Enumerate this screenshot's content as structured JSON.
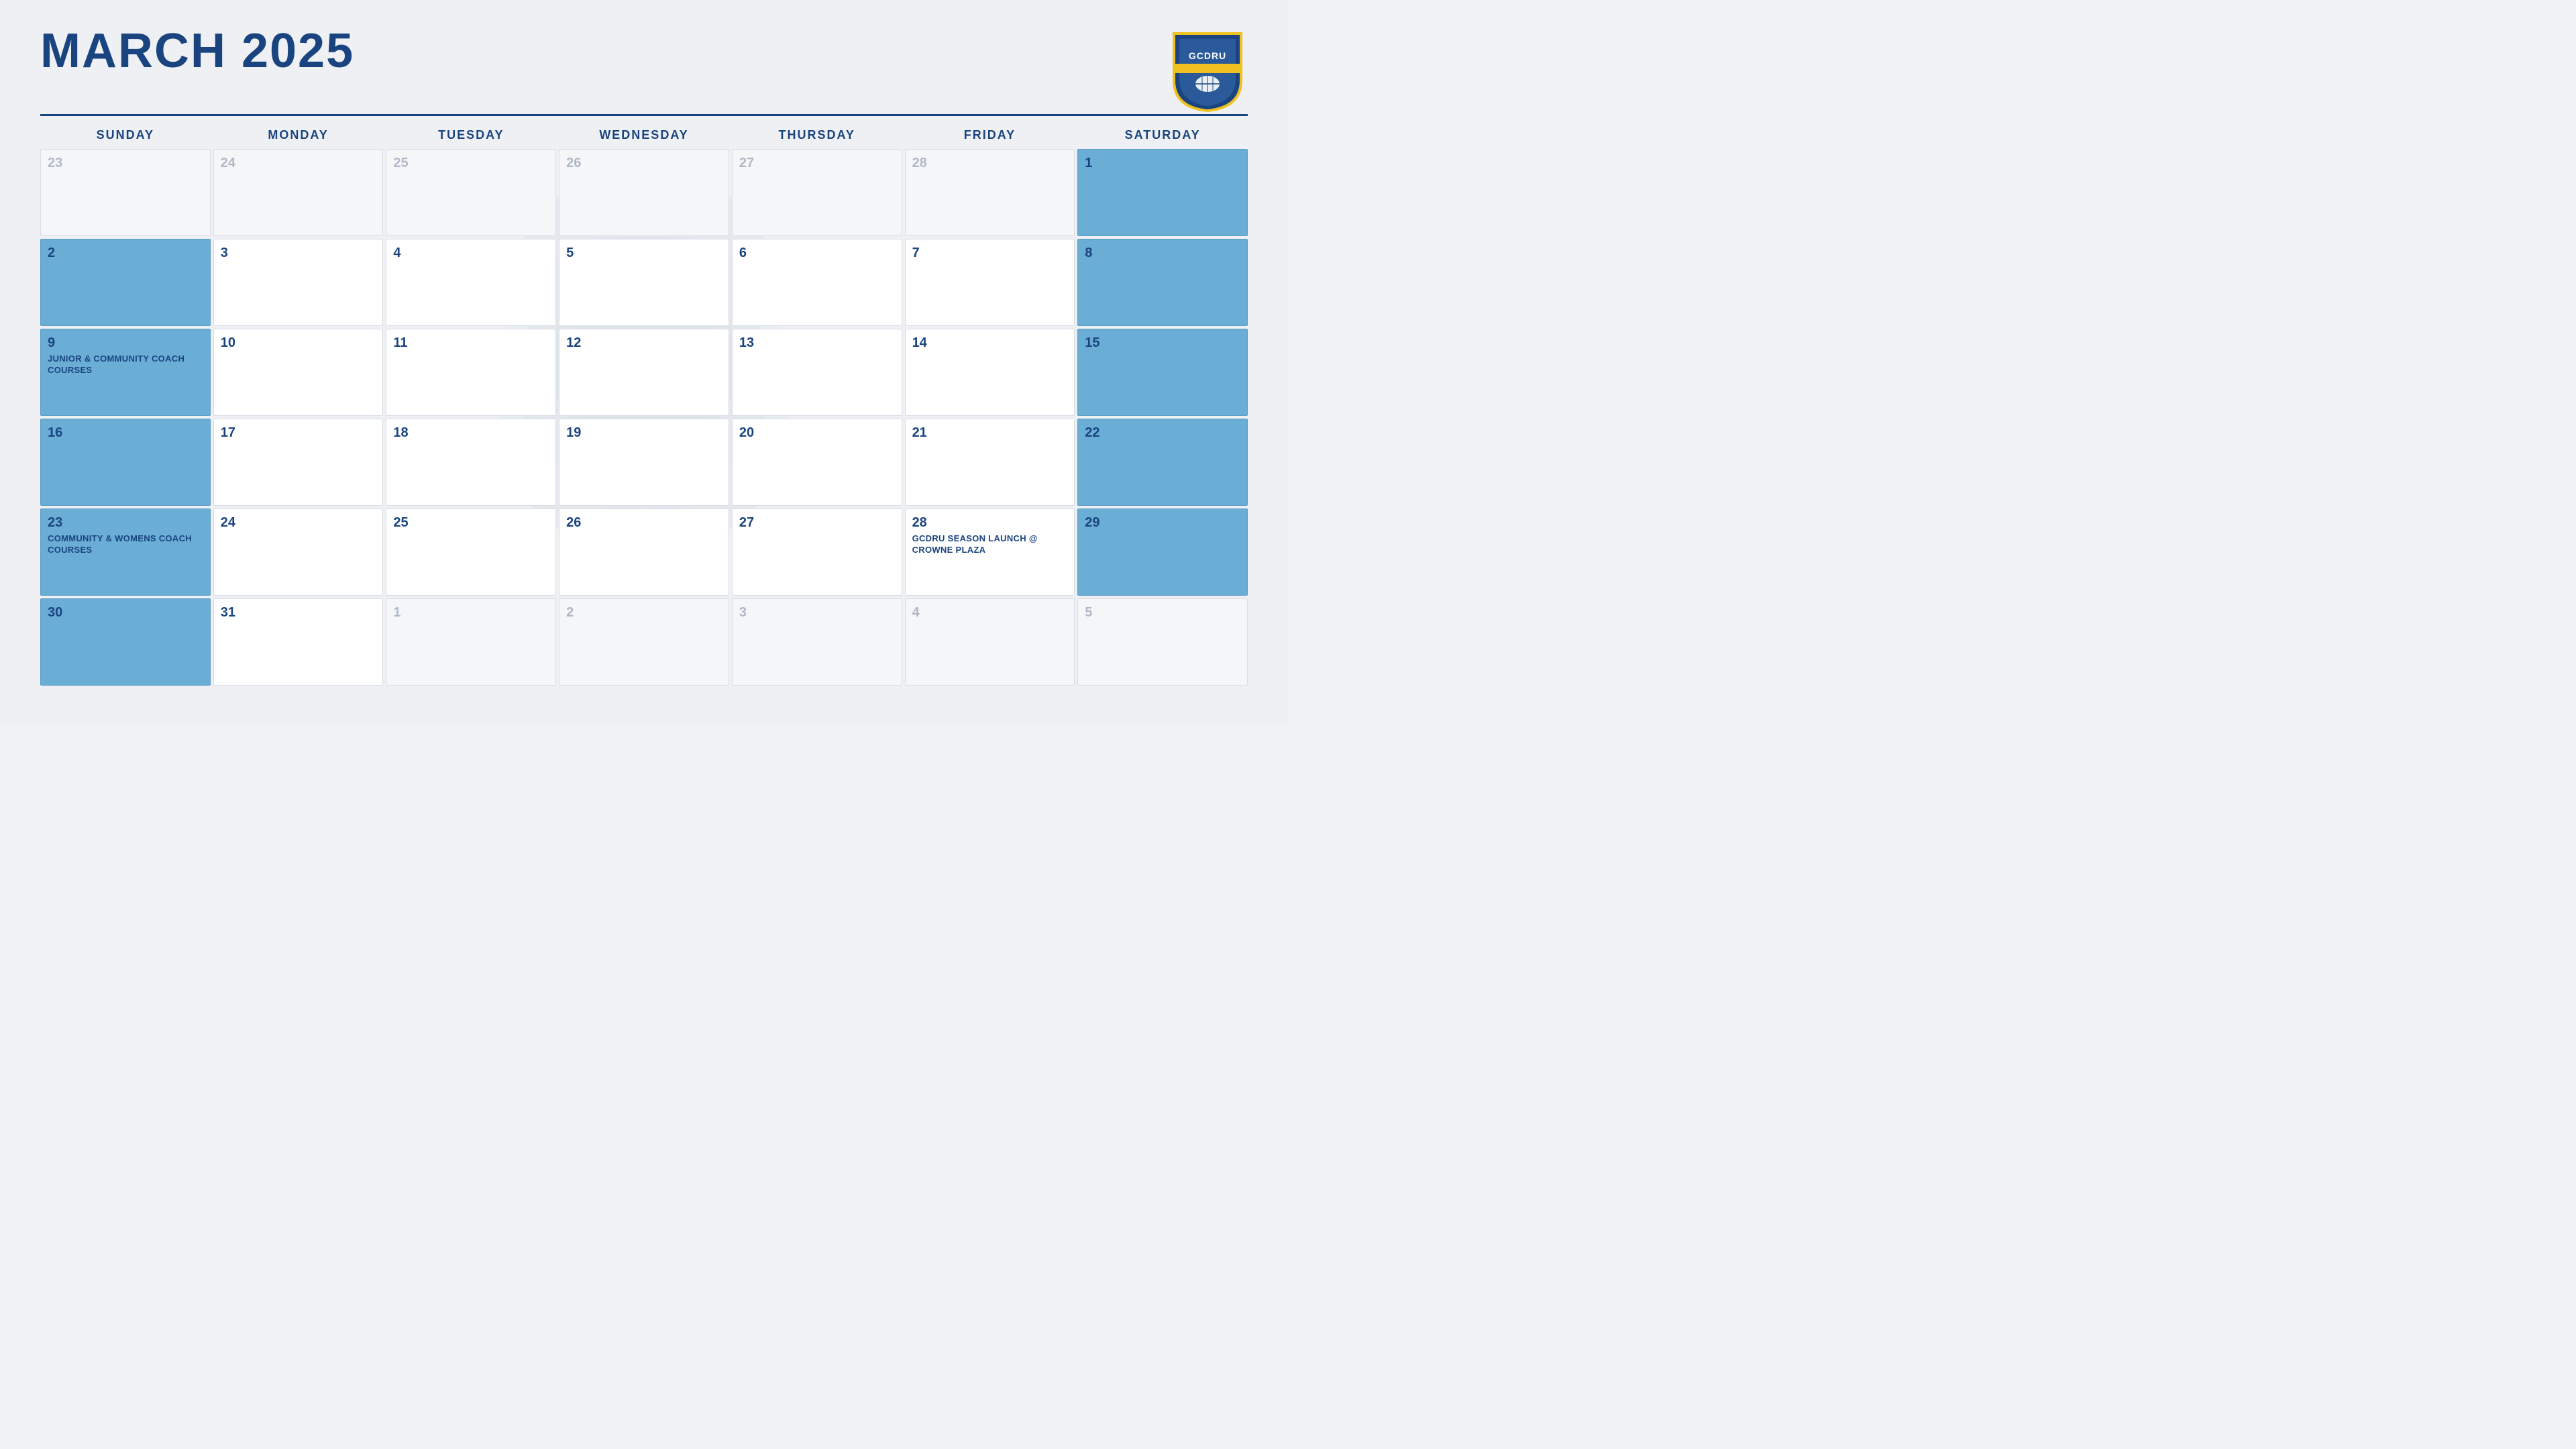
{
  "header": {
    "title": "MARCH 2025",
    "logo_alt": "GCDRU Logo"
  },
  "days": {
    "headers": [
      "SUNDAY",
      "MONDAY",
      "TUESDAY",
      "WEDNESDAY",
      "THURSDAY",
      "FRIDAY",
      "SATURDAY"
    ]
  },
  "weeks": [
    [
      {
        "number": "23",
        "type": "prev-month",
        "event": ""
      },
      {
        "number": "24",
        "type": "prev-month",
        "event": ""
      },
      {
        "number": "25",
        "type": "prev-month",
        "event": ""
      },
      {
        "number": "26",
        "type": "prev-month",
        "event": ""
      },
      {
        "number": "27",
        "type": "prev-month",
        "event": ""
      },
      {
        "number": "28",
        "type": "prev-month",
        "event": ""
      },
      {
        "number": "1",
        "type": "blue-cell",
        "event": ""
      }
    ],
    [
      {
        "number": "2",
        "type": "blue-cell",
        "event": ""
      },
      {
        "number": "3",
        "type": "normal",
        "event": ""
      },
      {
        "number": "4",
        "type": "normal",
        "event": ""
      },
      {
        "number": "5",
        "type": "normal",
        "event": ""
      },
      {
        "number": "6",
        "type": "normal",
        "event": ""
      },
      {
        "number": "7",
        "type": "normal",
        "event": ""
      },
      {
        "number": "8",
        "type": "blue-cell",
        "event": ""
      }
    ],
    [
      {
        "number": "9",
        "type": "blue-cell",
        "event": "JUNIOR & COMMUNITY COACH COURSES"
      },
      {
        "number": "10",
        "type": "normal",
        "event": ""
      },
      {
        "number": "11",
        "type": "normal",
        "event": ""
      },
      {
        "number": "12",
        "type": "normal",
        "event": ""
      },
      {
        "number": "13",
        "type": "normal",
        "event": ""
      },
      {
        "number": "14",
        "type": "normal",
        "event": ""
      },
      {
        "number": "15",
        "type": "blue-cell",
        "event": ""
      }
    ],
    [
      {
        "number": "16",
        "type": "blue-cell",
        "event": ""
      },
      {
        "number": "17",
        "type": "normal",
        "event": ""
      },
      {
        "number": "18",
        "type": "normal",
        "event": ""
      },
      {
        "number": "19",
        "type": "normal",
        "event": ""
      },
      {
        "number": "20",
        "type": "normal",
        "event": ""
      },
      {
        "number": "21",
        "type": "normal",
        "event": ""
      },
      {
        "number": "22",
        "type": "blue-cell",
        "event": ""
      }
    ],
    [
      {
        "number": "23",
        "type": "blue-cell",
        "event": "COMMUNITY & WOMENS COACH COURSES"
      },
      {
        "number": "24",
        "type": "normal",
        "event": ""
      },
      {
        "number": "25",
        "type": "normal",
        "event": ""
      },
      {
        "number": "26",
        "type": "normal",
        "event": ""
      },
      {
        "number": "27",
        "type": "normal",
        "event": ""
      },
      {
        "number": "28",
        "type": "normal",
        "event": "GCDRU SEASON LAUNCH @ CROWNE PLAZA"
      },
      {
        "number": "29",
        "type": "blue-cell",
        "event": ""
      }
    ],
    [
      {
        "number": "30",
        "type": "blue-cell",
        "event": ""
      },
      {
        "number": "31",
        "type": "normal",
        "event": ""
      },
      {
        "number": "1",
        "type": "next-month",
        "event": ""
      },
      {
        "number": "2",
        "type": "next-month",
        "event": ""
      },
      {
        "number": "3",
        "type": "next-month",
        "event": ""
      },
      {
        "number": "4",
        "type": "next-month",
        "event": ""
      },
      {
        "number": "5",
        "type": "next-month",
        "event": ""
      }
    ]
  ]
}
